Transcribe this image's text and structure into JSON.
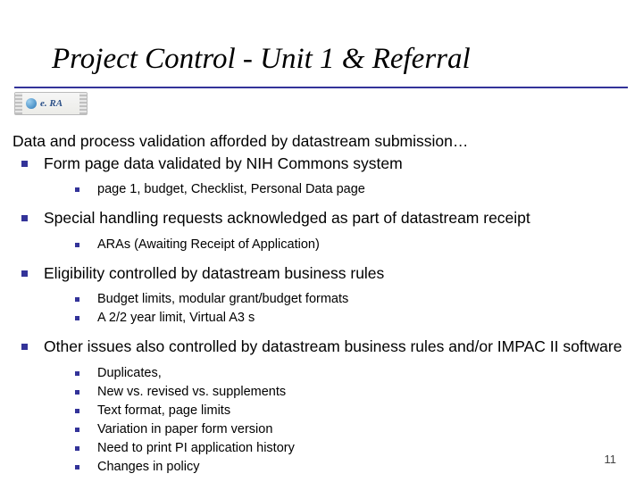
{
  "title": "Project Control -  Unit 1 & Referral",
  "logo_text": "e. RA",
  "intro": "Data and process validation afforded by datastream submission…",
  "b1": "Form page data validated by NIH Commons system",
  "b1_1": "page 1, budget, Checklist, Personal Data page",
  "b2": "Special handling requests acknowledged as part of datastream receipt",
  "b2_1": "ARAs (Awaiting Receipt of Application)",
  "b3": "Eligibility controlled by datastream business rules",
  "b3_1": "Budget limits, modular grant/budget formats",
  "b3_2": "A 2/2 year limit, Virtual A3 s",
  "b4": "Other issues also controlled by datastream business rules and/or IMPAC II software",
  "b4_1": "Duplicates,",
  "b4_2": "New vs. revised vs. supplements",
  "b4_3": "Text format, page limits",
  "b4_4": "Variation in paper form version",
  "b4_5": "Need to print PI application history",
  "b4_6": "Changes in policy",
  "page_number": "11"
}
